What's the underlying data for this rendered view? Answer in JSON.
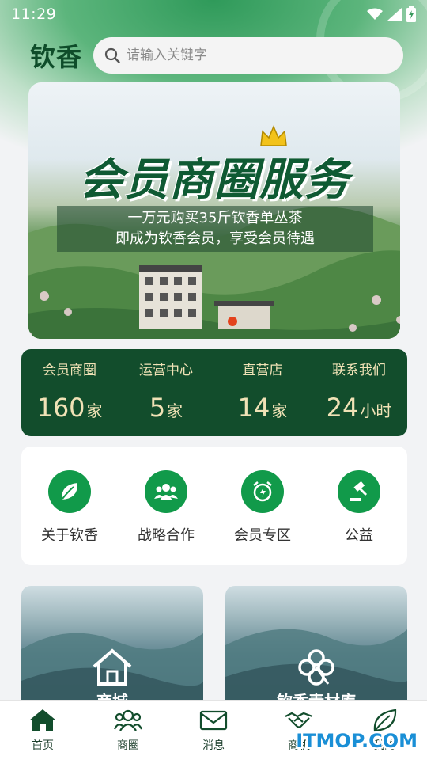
{
  "status_bar": {
    "time": "11:29"
  },
  "header": {
    "brand": "钦香",
    "search_placeholder": "请输入关键字"
  },
  "banner": {
    "title": "会员商圈服务",
    "subtitle_line1": "一万元购买35斤钦香单丛茶",
    "subtitle_line2": "即成为钦香会员，享受会员待遇"
  },
  "stats": [
    {
      "label": "会员商圈",
      "value": "160",
      "unit": "家"
    },
    {
      "label": "运营中心",
      "value": "5",
      "unit": "家"
    },
    {
      "label": "直营店",
      "value": "14",
      "unit": "家"
    },
    {
      "label": "联系我们",
      "value": "24",
      "unit": "小时"
    }
  ],
  "quick_links": [
    {
      "label": "关于钦香",
      "icon": "leaf-icon"
    },
    {
      "label": "战略合作",
      "icon": "group-icon"
    },
    {
      "label": "会员专区",
      "icon": "alarm-clock-icon"
    },
    {
      "label": "公益",
      "icon": "gavel-icon"
    }
  ],
  "cards": [
    {
      "label": "商城",
      "icon": "house-icon"
    },
    {
      "label": "钦香素材库",
      "icon": "clover-icon"
    }
  ],
  "tabbar": [
    {
      "label": "首页",
      "icon": "home-icon",
      "active": true
    },
    {
      "label": "商圈",
      "icon": "people-icon"
    },
    {
      "label": "消息",
      "icon": "mail-icon"
    },
    {
      "label": "商机",
      "icon": "handshake-icon"
    },
    {
      "label": "我的",
      "icon": "leaf-icon"
    }
  ],
  "watermark": "ITMOP.COM",
  "colors": {
    "brand_dark_green": "#124d2c",
    "accent_green": "#119a4a",
    "stat_text": "#f0e2b6"
  }
}
